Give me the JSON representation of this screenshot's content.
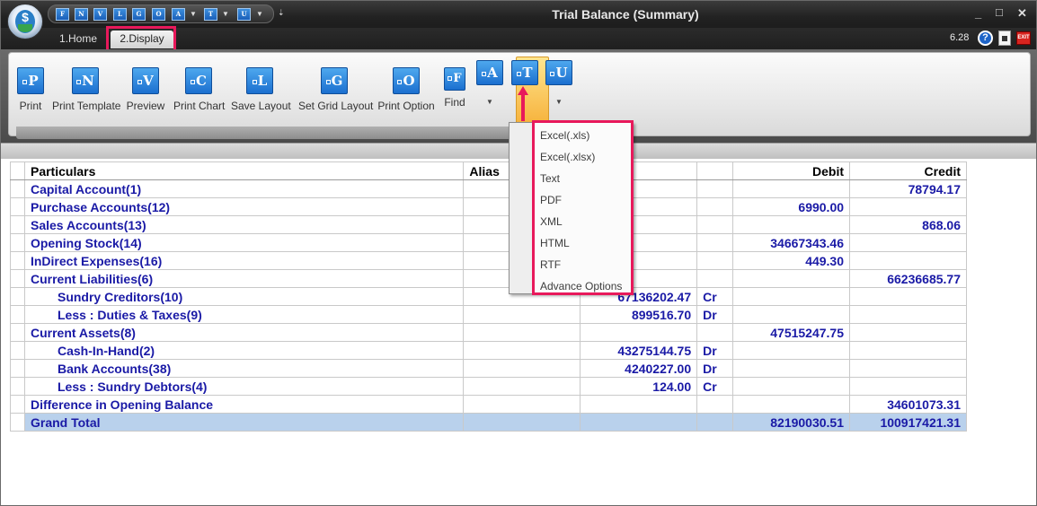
{
  "window": {
    "title": "Trial Balance (Summary)",
    "minimize": "_",
    "maximize": "□",
    "close": "✕"
  },
  "quick_access": {
    "buttons": [
      "F",
      "N",
      "V",
      "L",
      "G",
      "O",
      "A",
      "T",
      "U"
    ]
  },
  "tabs": {
    "home": "1.Home",
    "display": "2.Display",
    "active": "display"
  },
  "header_right": {
    "version": "6.28"
  },
  "ribbon": {
    "buttons": [
      {
        "glyph": "P",
        "label": "Print"
      },
      {
        "glyph": "N",
        "label": "Print Template"
      },
      {
        "glyph": "V",
        "label": "Preview"
      },
      {
        "glyph": "C",
        "label": "Print Chart"
      },
      {
        "glyph": "L",
        "label": "Save Layout"
      },
      {
        "glyph": "G",
        "label": "Set Grid Layout"
      },
      {
        "glyph": "O",
        "label": "Print Option"
      },
      {
        "glyph": "F",
        "label": "Find"
      }
    ],
    "small_buttons": [
      {
        "glyph": "A"
      },
      {
        "glyph": "T"
      },
      {
        "glyph": "U"
      }
    ]
  },
  "export_menu": {
    "items": [
      "Excel(.xls)",
      "Excel(.xlsx)",
      "Text",
      "PDF",
      "XML",
      "HTML",
      "RTF",
      "Advance Options"
    ]
  },
  "grid": {
    "columns": {
      "particulars": "Particulars",
      "alias": "Alias",
      "amount": "",
      "drcr": "",
      "debit": "Debit",
      "credit": "Credit"
    },
    "rows": [
      {
        "particulars": "Capital Account(1)",
        "alias": "",
        "amount": "",
        "drcr": "",
        "debit": "",
        "credit": "78794.17",
        "indent": false
      },
      {
        "particulars": "Purchase Accounts(12)",
        "alias": "",
        "amount": "",
        "drcr": "",
        "debit": "6990.00",
        "credit": "",
        "indent": false
      },
      {
        "particulars": "Sales Accounts(13)",
        "alias": "",
        "amount": "",
        "drcr": "",
        "debit": "",
        "credit": "868.06",
        "indent": false
      },
      {
        "particulars": "Opening Stock(14)",
        "alias": "",
        "amount": "",
        "drcr": "",
        "debit": "34667343.46",
        "credit": "",
        "indent": false
      },
      {
        "particulars": "InDirect Expenses(16)",
        "alias": "",
        "amount": "",
        "drcr": "",
        "debit": "449.30",
        "credit": "",
        "indent": false
      },
      {
        "particulars": "Current Liabilities(6)",
        "alias": "",
        "amount": "",
        "drcr": "",
        "debit": "",
        "credit": "66236685.77",
        "indent": false
      },
      {
        "particulars": "Sundry Creditors(10)",
        "alias": "",
        "amount": "67136202.47",
        "drcr": "Cr",
        "debit": "",
        "credit": "",
        "indent": true
      },
      {
        "particulars": "Less : Duties & Taxes(9)",
        "alias": "",
        "amount": "899516.70",
        "drcr": "Dr",
        "debit": "",
        "credit": "",
        "indent": true
      },
      {
        "particulars": "Current Assets(8)",
        "alias": "",
        "amount": "",
        "drcr": "",
        "debit": "47515247.75",
        "credit": "",
        "indent": false
      },
      {
        "particulars": "Cash-In-Hand(2)",
        "alias": "",
        "amount": "43275144.75",
        "drcr": "Dr",
        "debit": "",
        "credit": "",
        "indent": true
      },
      {
        "particulars": "Bank Accounts(38)",
        "alias": "",
        "amount": "4240227.00",
        "drcr": "Dr",
        "debit": "",
        "credit": "",
        "indent": true
      },
      {
        "particulars": "Less : Sundry Debtors(4)",
        "alias": "",
        "amount": "124.00",
        "drcr": "Cr",
        "debit": "",
        "credit": "",
        "indent": true
      },
      {
        "particulars": "Difference in Opening Balance",
        "alias": "",
        "amount": "",
        "drcr": "",
        "debit": "",
        "credit": "34601073.31",
        "indent": false
      }
    ],
    "total": {
      "particulars": "Grand Total",
      "alias": "",
      "amount": "",
      "drcr": "",
      "debit": "82190030.51",
      "credit": "100917421.31"
    }
  },
  "colors": {
    "highlight": "#e8195b",
    "text_blue": "#1a1aa6",
    "total_row": "#b9d1ec",
    "accent_blue": "#1b6fcf"
  }
}
